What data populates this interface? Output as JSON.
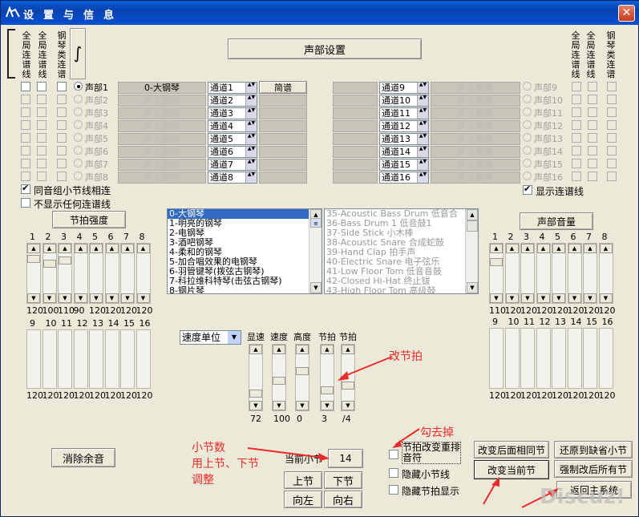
{
  "title": "设置与信息",
  "close": "✕",
  "voice_setup": "声部设置",
  "col_labels": {
    "all_staff": "全局连谱线",
    "all_staff2": "全局连谱线",
    "piano": "钢琴类连谱",
    "brace": "∫"
  },
  "left_voices": [
    {
      "label": "声部1",
      "instr": "0-大钢琴",
      "chan": "通道1"
    },
    {
      "label": "声部2",
      "instr": "0-大钢琴",
      "chan": "通道2"
    },
    {
      "label": "声部3",
      "instr": "0-大钢琴",
      "chan": "通道3"
    },
    {
      "label": "声部4",
      "instr": "0-大钢琴",
      "chan": "通道4"
    },
    {
      "label": "声部5",
      "instr": "0-大钢琴",
      "chan": "通道5"
    },
    {
      "label": "声部6",
      "instr": "0-大钢琴",
      "chan": "通道6"
    },
    {
      "label": "声部7",
      "instr": "0-大钢琴",
      "chan": "通道7"
    },
    {
      "label": "声部8",
      "instr": "0-大钢琴",
      "chan": "通道8"
    }
  ],
  "right_voices": [
    {
      "label": "声部9",
      "instr": "0-大钢琴",
      "chan": "通道9"
    },
    {
      "label": "声部10",
      "instr": "0-大钢琴",
      "chan": "通道10"
    },
    {
      "label": "声部11",
      "instr": "0-大钢琴",
      "chan": "通道11"
    },
    {
      "label": "声部12",
      "instr": "0-大钢琴",
      "chan": "通道12"
    },
    {
      "label": "声部13",
      "instr": "0-大钢琴",
      "chan": "通道13"
    },
    {
      "label": "声部14",
      "instr": "0-大钢琴",
      "chan": "通道14"
    },
    {
      "label": "声部15",
      "instr": "0-大钢琴",
      "chan": "通道15"
    },
    {
      "label": "声部16",
      "instr": "0-大钢琴",
      "chan": "通道16"
    }
  ],
  "simple_score": "简谱",
  "same_group_link": "同音组小节线相连",
  "no_staff_line": "不显示任何连谱线",
  "show_staff_line": "显示连谱线",
  "beat_strength": "节拍强度",
  "voice_volume": "声部音量",
  "instruments_list": [
    "0-大钢琴",
    "1-明亮的钢琴",
    "2-电钢琴",
    "3-酒吧钢琴",
    "4-柔和的钢琴",
    "5-加合唱效果的电钢琴",
    "6-羽管键琴(拨弦古钢琴)",
    "7-科拉维科特琴(击弦古钢琴)",
    "8-钢片琴"
  ],
  "drum_list": [
    "35-Acoustic Bass Drum  低音合",
    "36-Bass Drum 1 低音鼓1",
    "37-Side Stick 小木棒",
    "38-Acoustic Snare 合成蛇鼓",
    "39-Hand Clap 拍手声",
    "40-Electric Snare 电子弦乐",
    "41-Low Floor Tom 低音音鼓",
    "42-Closed Hi-Hat 终止钹",
    "43-High Floor Tom 高级鼓"
  ],
  "beat_top_nums": [
    "1",
    "2",
    "3",
    "4",
    "5",
    "6",
    "7",
    "8"
  ],
  "beat_top_vals": [
    "120",
    "100",
    "110",
    "90",
    "120",
    "120",
    "120",
    "120"
  ],
  "beat_bot_nums": [
    "9",
    "10",
    "11",
    "12",
    "13",
    "14",
    "15",
    "16"
  ],
  "beat_bot_vals": [
    "120",
    "120",
    "120",
    "120",
    "120",
    "120",
    "120",
    "120"
  ],
  "vol_top_nums": [
    "1",
    "2",
    "3",
    "4",
    "5",
    "6",
    "7",
    "8"
  ],
  "vol_top_vals": [
    "110",
    "120",
    "120",
    "120",
    "120",
    "120",
    "120",
    "120"
  ],
  "vol_bot_nums": [
    "9",
    "10",
    "11",
    "12",
    "13",
    "14",
    "15",
    "16"
  ],
  "vol_bot_vals": [
    "120",
    "120",
    "120",
    "120",
    "120",
    "120",
    "120",
    "120"
  ],
  "speed_unit": "速度单位",
  "tempo_labels": [
    "显速",
    "速度",
    "高度",
    "节拍",
    "节拍"
  ],
  "tempo_vals": [
    "72",
    "100",
    "0",
    "3",
    "/4"
  ],
  "clear_button": "消除余音",
  "current_bar_label": "当前小节",
  "current_bar_value": "14",
  "prev_bar": "上节",
  "next_bar": "下节",
  "left": "向左",
  "right": "向右",
  "beat_change_checkbox": "节拍改变重排音符",
  "hide_bar_line": "隐藏小节线",
  "hide_beat": "隐藏节拍显示",
  "change_following": "改变后面相同节",
  "restore_default": "还原到缺省小节",
  "change_current": "改变当前节",
  "force_all": "强制改后所有节",
  "return_main": "返回主系统",
  "annotation_beat": "改节拍",
  "annotation_uncheck": "勾去掉",
  "annotation_bar": "小节数\n用上节、下节\n调整",
  "watermark": "Discuz!"
}
